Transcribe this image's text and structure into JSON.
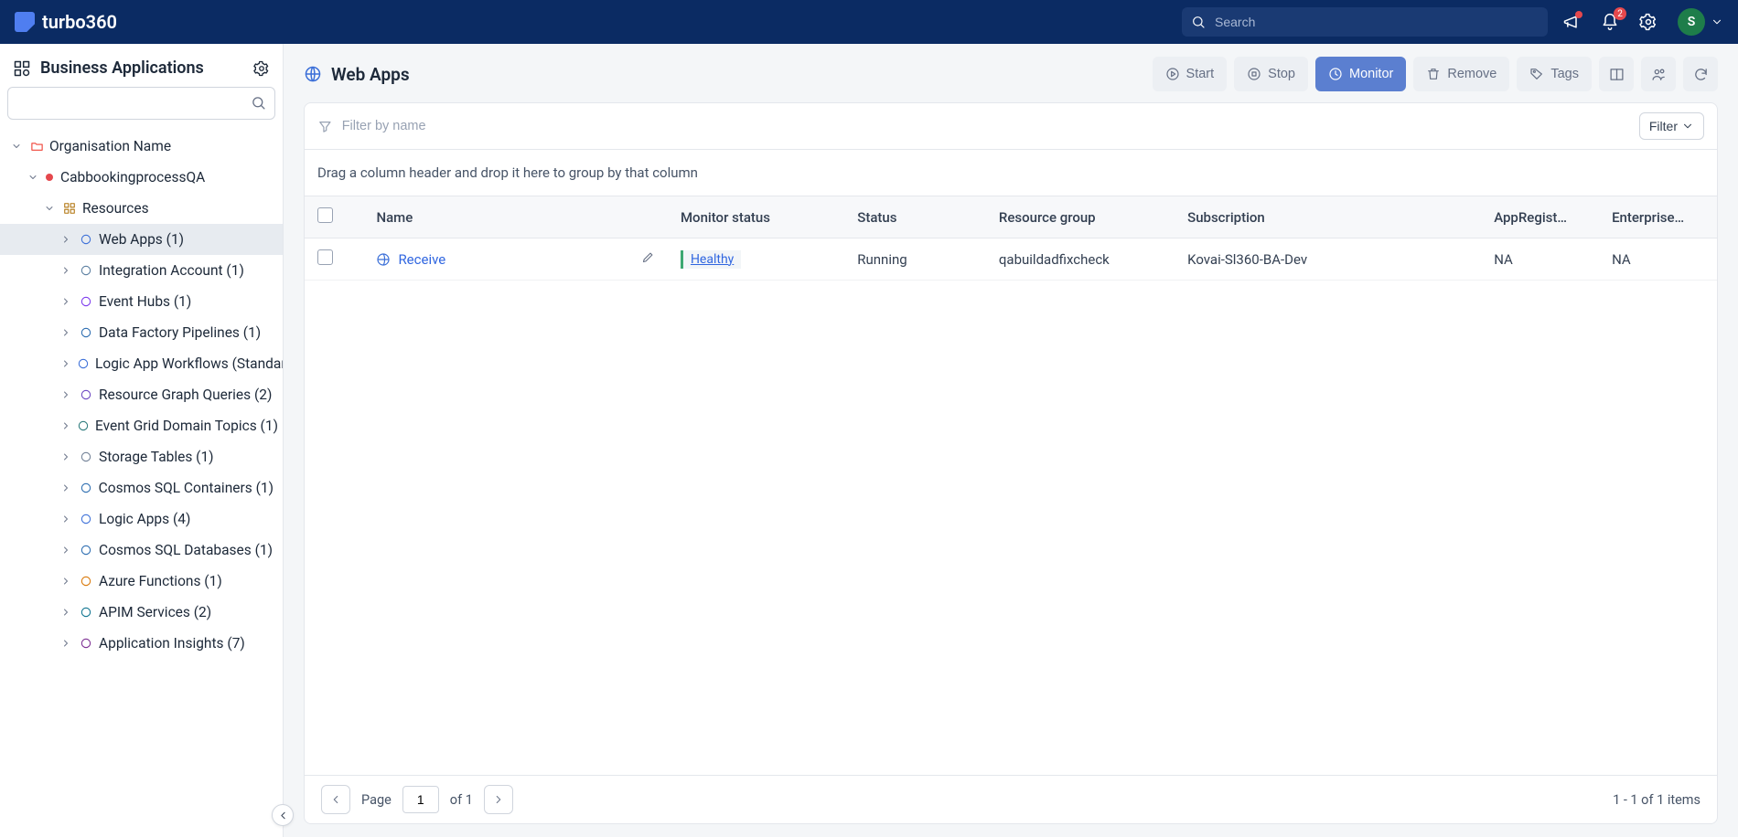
{
  "header": {
    "brand": "turbo360",
    "search_placeholder": "Search",
    "notif_count": "2",
    "avatar_initial": "S"
  },
  "sidebar": {
    "title": "Business Applications",
    "org": "Organisation Name",
    "profile": "CabbookingprocessQA",
    "container": "Resources",
    "items": [
      {
        "label": "Web Apps (1)",
        "selected": true
      },
      {
        "label": "Integration Account (1)"
      },
      {
        "label": "Event Hubs (1)"
      },
      {
        "label": "Data Factory Pipelines (1)"
      },
      {
        "label": "Logic App Workflows (Standard)"
      },
      {
        "label": "Resource Graph Queries (2)"
      },
      {
        "label": "Event Grid Domain Topics (1)"
      },
      {
        "label": "Storage Tables (1)"
      },
      {
        "label": "Cosmos SQL Containers (1)"
      },
      {
        "label": "Logic Apps (4)"
      },
      {
        "label": "Cosmos SQL Databases (1)"
      },
      {
        "label": "Azure Functions (1)"
      },
      {
        "label": "APIM Services (2)"
      },
      {
        "label": "Application Insights (7)"
      }
    ]
  },
  "page": {
    "title": "Web Apps",
    "actions": {
      "start": "Start",
      "stop": "Stop",
      "monitor": "Monitor",
      "remove": "Remove",
      "tags": "Tags"
    },
    "filter_placeholder": "Filter by name",
    "filter_btn": "Filter",
    "group_hint": "Drag a column header and drop it here to group by that column",
    "columns": {
      "name": "Name",
      "monitor": "Monitor status",
      "status": "Status",
      "rg": "Resource group",
      "sub": "Subscription",
      "app": "AppRegist…",
      "ent": "Enterprise…"
    },
    "rows": [
      {
        "name": "Receive",
        "monitor": "Healthy",
        "status": "Running",
        "rg": "qabuildadfixcheck",
        "sub": "Kovai-Sl360-BA-Dev",
        "app": "NA",
        "ent": "NA"
      }
    ],
    "pager": {
      "page_label": "Page",
      "page_value": "1",
      "of_label": "of 1",
      "summary": "1 - 1 of 1 items"
    }
  }
}
